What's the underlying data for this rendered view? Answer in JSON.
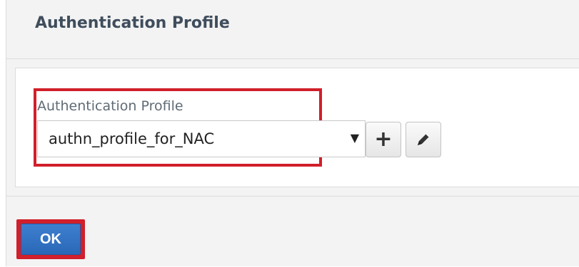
{
  "header": {
    "title": "Authentication Profile"
  },
  "form": {
    "field_label": "Authentication Profile",
    "selected_value": "authn_profile_for_NAC",
    "dropdown_arrow": "▼",
    "add_icon": "plus-icon",
    "edit_icon": "pencil-icon"
  },
  "footer": {
    "ok_label": "OK"
  },
  "colors": {
    "highlight": "#d11f2b",
    "primary_button": "#2f72c5",
    "title_text": "#3f4d5c",
    "panel_background": "#f3f3f3"
  }
}
